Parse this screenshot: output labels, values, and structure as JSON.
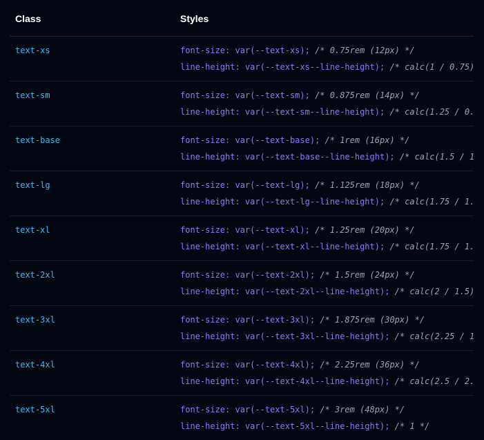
{
  "header": {
    "class_label": "Class",
    "styles_label": "Styles"
  },
  "rows": [
    {
      "class": "text-xs",
      "fs_code": "font-size: var(--text-xs);",
      "fs_comment": "/* 0.75rem (12px) */",
      "lh_code": "line-height: var(--text-xs--line-height);",
      "lh_comment": "/* calc(1 / 0.75)"
    },
    {
      "class": "text-sm",
      "fs_code": "font-size: var(--text-sm);",
      "fs_comment": "/* 0.875rem (14px) */",
      "lh_code": "line-height: var(--text-sm--line-height);",
      "lh_comment": "/* calc(1.25 / 0."
    },
    {
      "class": "text-base",
      "fs_code": "font-size: var(--text-base);",
      "fs_comment": "/* 1rem (16px) */",
      "lh_code": "line-height: var(--text-base--line-height);",
      "lh_comment": "/* calc(1.5 / 1"
    },
    {
      "class": "text-lg",
      "fs_code": "font-size: var(--text-lg);",
      "fs_comment": "/* 1.125rem (18px) */",
      "lh_code": "line-height: var(--text-lg--line-height);",
      "lh_comment": "/* calc(1.75 / 1."
    },
    {
      "class": "text-xl",
      "fs_code": "font-size: var(--text-xl);",
      "fs_comment": "/* 1.25rem (20px) */",
      "lh_code": "line-height: var(--text-xl--line-height);",
      "lh_comment": "/* calc(1.75 / 1."
    },
    {
      "class": "text-2xl",
      "fs_code": "font-size: var(--text-2xl);",
      "fs_comment": "/* 1.5rem (24px) */",
      "lh_code": "line-height: var(--text-2xl--line-height);",
      "lh_comment": "/* calc(2 / 1.5)"
    },
    {
      "class": "text-3xl",
      "fs_code": "font-size: var(--text-3xl);",
      "fs_comment": "/* 1.875rem (30px) */",
      "lh_code": "line-height: var(--text-3xl--line-height);",
      "lh_comment": "/* calc(2.25 / 1"
    },
    {
      "class": "text-4xl",
      "fs_code": "font-size: var(--text-4xl);",
      "fs_comment": "/* 2.25rem (36px) */",
      "lh_code": "line-height: var(--text-4xl--line-height);",
      "lh_comment": "/* calc(2.5 / 2."
    },
    {
      "class": "text-5xl",
      "fs_code": "font-size: var(--text-5xl);",
      "fs_comment": "/* 3rem (48px) */",
      "lh_code": "line-height: var(--text-5xl--line-height);",
      "lh_comment": "/* 1 */"
    }
  ],
  "colors": {
    "background": "#030712",
    "class_text": "#38bdf8",
    "code_text": "#8b7cf6",
    "comment_text": "#9ca3af"
  }
}
